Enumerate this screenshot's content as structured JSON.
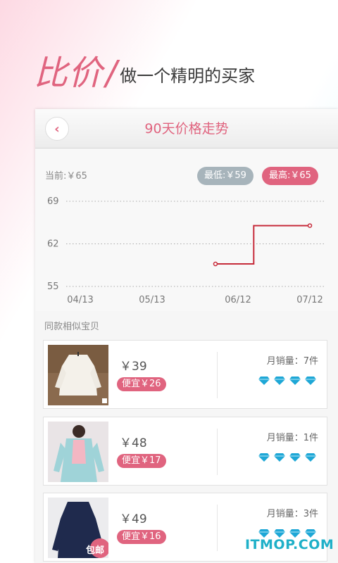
{
  "banner": {
    "main": "比价",
    "sub": "做一个精明的买家"
  },
  "header": {
    "title": "90天价格走势"
  },
  "prices": {
    "current": "当前:￥65",
    "min": "最低:￥59",
    "max": "最高:￥65"
  },
  "chart_data": {
    "type": "line",
    "x_ticks": [
      "04/13",
      "05/13",
      "06/12",
      "07/12"
    ],
    "y_ticks": [
      "69",
      "62",
      "55"
    ],
    "ylim": [
      55,
      69
    ],
    "series": [
      {
        "points": [
          {
            "x": "06/05",
            "y": 58.7
          },
          {
            "x": "06/20",
            "y": 58.7
          },
          {
            "x": "06/20",
            "y": 65
          },
          {
            "x": "07/12",
            "y": 65
          }
        ]
      }
    ],
    "color": "#c62b3a",
    "grid": true
  },
  "similar": {
    "label": "同款相似宝贝",
    "items": [
      {
        "price": "￥39",
        "cheaper": "便宜￥26",
        "sales": "月销量：7件",
        "rating": 4,
        "badge": ""
      },
      {
        "price": "￥48",
        "cheaper": "便宜￥17",
        "sales": "月销量：1件",
        "rating": 4,
        "badge": ""
      },
      {
        "price": "￥49",
        "cheaper": "便宜￥16",
        "sales": "月销量：3件",
        "rating": 4,
        "badge": "包邮"
      }
    ]
  },
  "watermark": "ITMOP.COM",
  "colors": {
    "accent": "#e0647f",
    "min_pill": "#a7b4bb",
    "line": "#c62b3a",
    "diamond": "#1ea7d6"
  }
}
